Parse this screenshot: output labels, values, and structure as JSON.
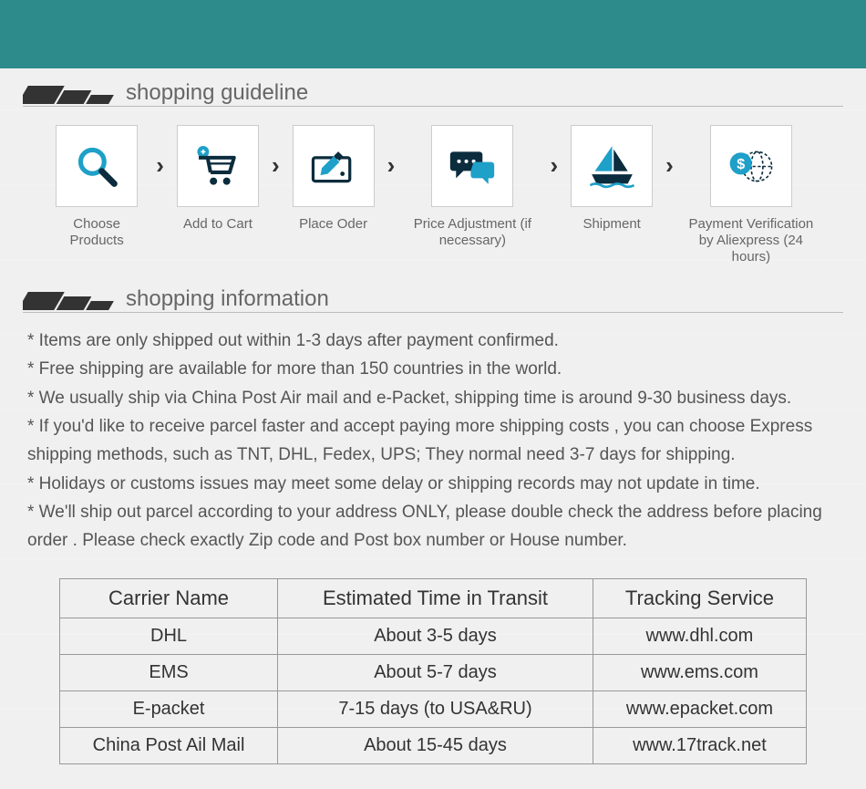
{
  "sections": {
    "guideline_title": "shopping guideline",
    "info_title": "shopping information"
  },
  "steps": [
    {
      "id": "choose",
      "label": "Choose Products"
    },
    {
      "id": "cart",
      "label": "Add to Cart"
    },
    {
      "id": "order",
      "label": "Place Oder"
    },
    {
      "id": "price",
      "label": "Price Adjustment (if necessary)"
    },
    {
      "id": "ship",
      "label": "Shipment"
    },
    {
      "id": "payment",
      "label": "Payment Verification by  Aliexpress (24 hours)"
    }
  ],
  "notes": [
    "* Items are only shipped out within 1-3 days after payment confirmed.",
    "* Free shipping are available for more than 150 countries in the world.",
    "* We usually ship via China Post Air mail and e-Packet, shipping time is around 9-30 business days.",
    "* If you'd like to receive parcel faster and accept paying more shipping costs , you can choose Express shipping methods, such as TNT, DHL, Fedex, UPS; They normal need 3-7 days for shipping.",
    "* Holidays or customs issues may meet some delay or shipping records may not update in time.",
    "* We'll ship out parcel according to your address ONLY, please double check the address before placing order . Please check exactly Zip code and Post box number or House number."
  ],
  "table": {
    "headers": [
      "Carrier Name",
      "Estimated Time in Transit",
      "Tracking Service"
    ],
    "rows": [
      [
        "DHL",
        "About 3-5 days",
        "www.dhl.com"
      ],
      [
        "EMS",
        "About 5-7 days",
        "www.ems.com"
      ],
      [
        "E-packet",
        "7-15 days (to USA&RU)",
        "www.epacket.com"
      ],
      [
        "China Post Ail Mail",
        "About 15-45 days",
        "www.17track.net"
      ]
    ]
  }
}
